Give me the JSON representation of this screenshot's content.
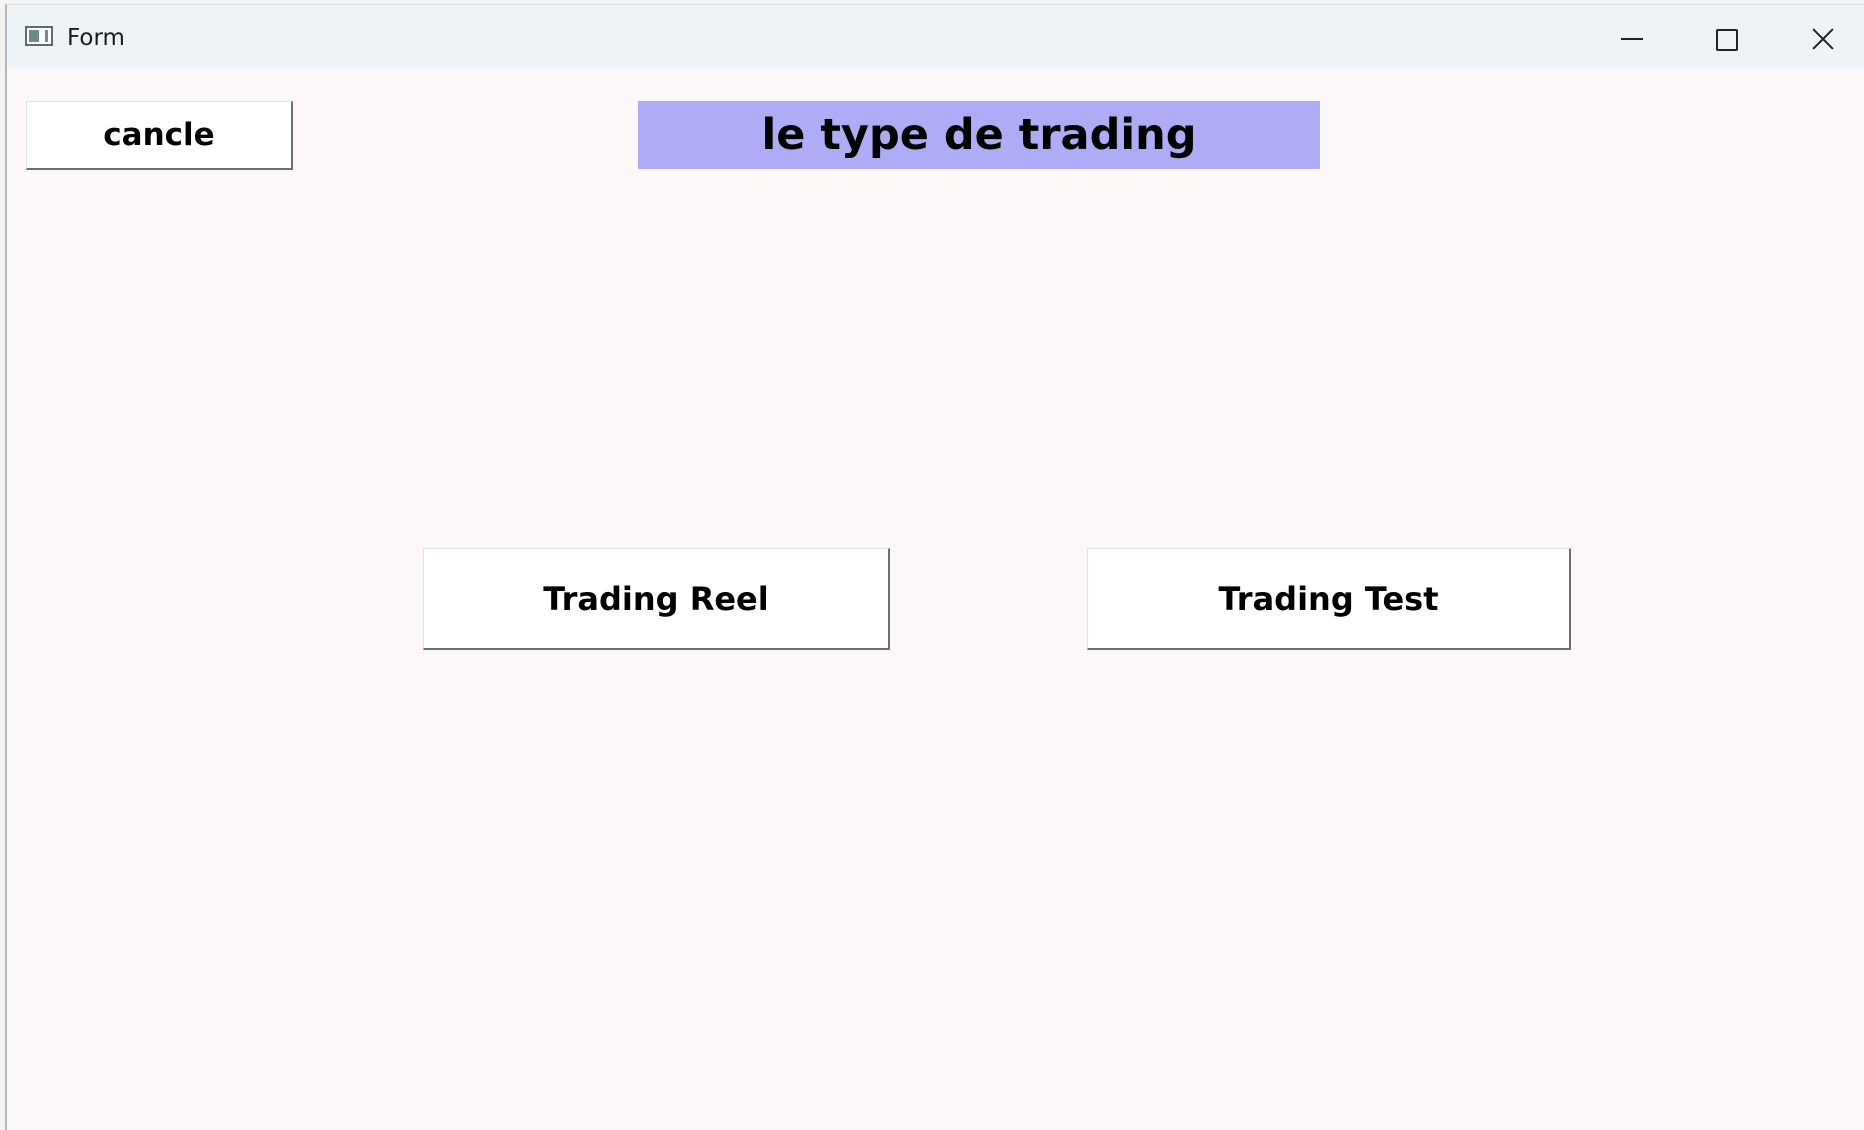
{
  "window": {
    "title": "Form",
    "controls": {
      "minimize_icon": "minimize-icon",
      "maximize_icon": "maximize-icon",
      "close_icon": "close-icon"
    }
  },
  "form": {
    "cancel_label": "cancle",
    "heading": "le type de trading",
    "real_trading_label": "Trading Reel",
    "test_trading_label": "Trading Test"
  },
  "colors": {
    "heading_background": "#aeacf5",
    "window_background": "#fdf8f8",
    "titlebar_background": "#eef3f7"
  }
}
